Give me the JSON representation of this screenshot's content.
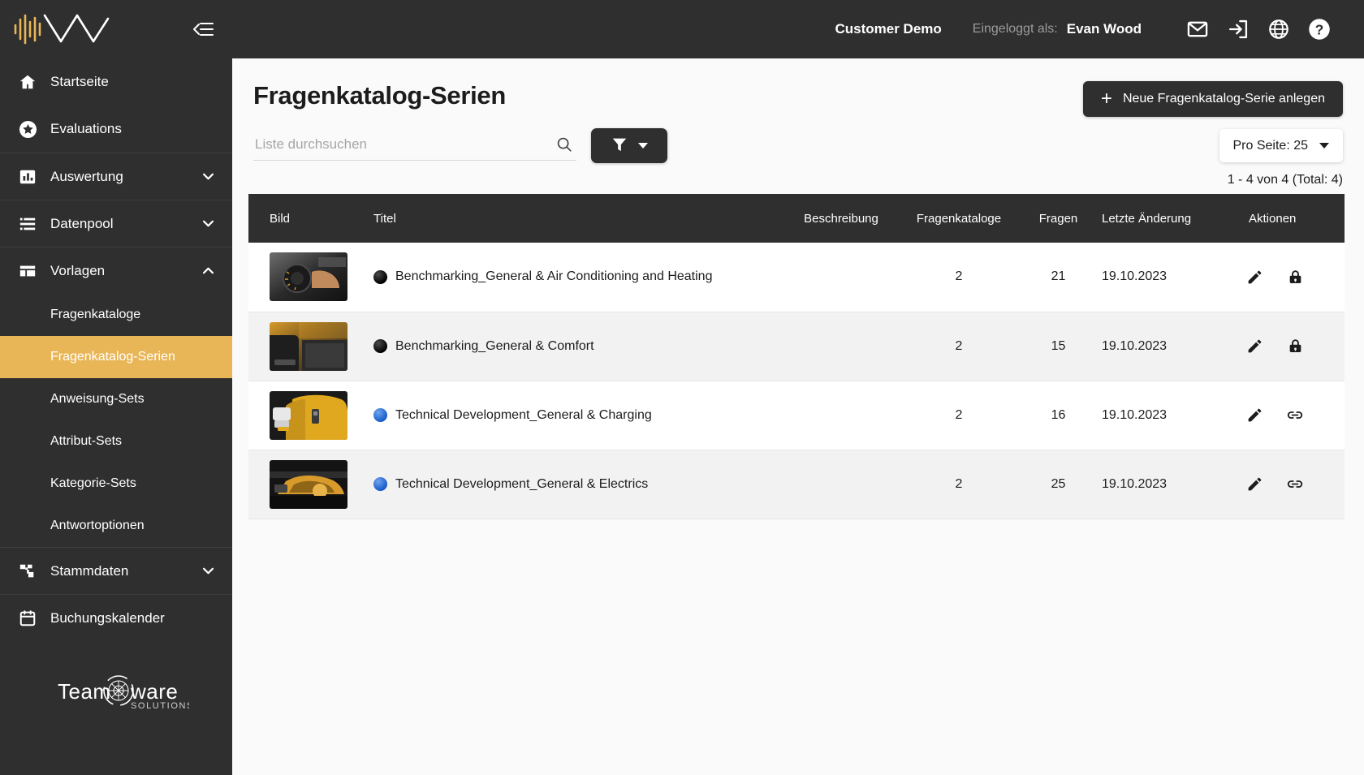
{
  "brand": {
    "logo_alt": "brand-logo",
    "collapse_label": "collapse-sidebar"
  },
  "topbar": {
    "customer": "Customer Demo",
    "logged_in_label": "Eingeloggt als:",
    "username": "Evan Wood",
    "icons": [
      "mail-icon",
      "logout-icon",
      "globe-icon",
      "help-icon"
    ]
  },
  "sidebar": {
    "items": [
      {
        "label": "Startseite",
        "icon": "home-icon",
        "expandable": false
      },
      {
        "label": "Evaluations",
        "icon": "star-icon",
        "expandable": false
      },
      {
        "label": "Auswertung",
        "icon": "bar-chart-icon",
        "expandable": true,
        "expanded": false
      },
      {
        "label": "Datenpool",
        "icon": "list-icon",
        "expandable": true,
        "expanded": false
      },
      {
        "label": "Vorlagen",
        "icon": "layout-icon",
        "expandable": true,
        "expanded": true
      },
      {
        "label": "Stammdaten",
        "icon": "sitemap-icon",
        "expandable": true,
        "expanded": false
      },
      {
        "label": "Buchungskalender",
        "icon": "calendar-icon",
        "expandable": false
      }
    ],
    "sub_items": [
      {
        "label": "Fragenkataloge",
        "active": false
      },
      {
        "label": "Fragenkatalog-Serien",
        "active": true
      },
      {
        "label": "Anweisung-Sets",
        "active": false
      },
      {
        "label": "Attribut-Sets",
        "active": false
      },
      {
        "label": "Kategorie-Sets",
        "active": false
      },
      {
        "label": "Antwortoptionen",
        "active": false
      }
    ],
    "footer_logo": {
      "text_left": "Team",
      "text_right": "ware",
      "subtext": "SOLUTIONS"
    },
    "active_color": "#e9b657"
  },
  "page": {
    "title": "Fragenkatalog-Serien",
    "new_button": "Neue Fragenkatalog-Serie anlegen",
    "new_button_plus": "+",
    "search_placeholder": "Liste durchsuchen",
    "search_value": "",
    "filter_icon": "filter-icon",
    "per_page": "Pro Seite: 25",
    "result_count": "1 - 4 von 4 (Total: 4)"
  },
  "table": {
    "columns": [
      "Bild",
      "Titel",
      "Beschreibung",
      "Fragenkataloge",
      "Fragen",
      "Letzte Änderung",
      "Aktionen"
    ],
    "rows": [
      {
        "image_alt": "car-dashboard-dial-thumbnail",
        "dot": "black",
        "title": "Benchmarking_General & Air Conditioning and Heating",
        "beschreibung": "",
        "fragenkataloge": "2",
        "fragen": "21",
        "letzte_aenderung": "19.10.2023",
        "actions": [
          "edit-icon",
          "lock-icon"
        ]
      },
      {
        "image_alt": "car-interior-seats-thumbnail",
        "dot": "black",
        "title": "Benchmarking_General & Comfort",
        "beschreibung": "",
        "fragenkataloge": "2",
        "fragen": "15",
        "letzte_aenderung": "19.10.2023",
        "actions": [
          "edit-icon",
          "lock-icon"
        ]
      },
      {
        "image_alt": "yellow-car-charging-thumbnail",
        "dot": "blue",
        "title": "Technical Development_General & Charging",
        "beschreibung": "",
        "fragenkataloge": "2",
        "fragen": "16",
        "letzte_aenderung": "19.10.2023",
        "actions": [
          "edit-icon",
          "link-icon"
        ]
      },
      {
        "image_alt": "car-engine-bay-thumbnail",
        "dot": "blue",
        "title": "Technical Development_General & Electrics",
        "beschreibung": "",
        "fragenkataloge": "2",
        "fragen": "25",
        "letzte_aenderung": "19.10.2023",
        "actions": [
          "edit-icon",
          "link-icon"
        ]
      }
    ]
  }
}
